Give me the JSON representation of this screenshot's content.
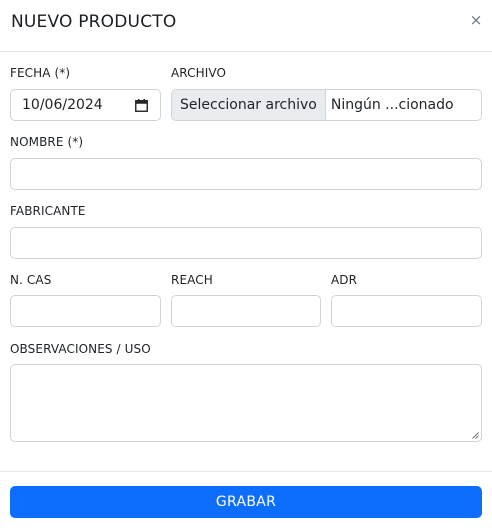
{
  "modal": {
    "title": "NUEVO PRODUCTO",
    "close_symbol": "×"
  },
  "form": {
    "fecha_label": "FECHA (*)",
    "fecha_value": "10/06/2024",
    "archivo_label": "ARCHIVO",
    "archivo_button": "Seleccionar archivo",
    "archivo_status": "Ningún ...cionado",
    "nombre_label": "NOMBRE (*)",
    "nombre_value": "",
    "fabricante_label": "FABRICANTE",
    "fabricante_value": "",
    "ncas_label": "N. CAS",
    "ncas_value": "",
    "reach_label": "REACH",
    "reach_value": "",
    "adr_label": "ADR",
    "adr_value": "",
    "observaciones_label": "OBSERVACIONES / USO",
    "observaciones_value": ""
  },
  "footer": {
    "submit_label": "GRABAR"
  },
  "colors": {
    "primary": "#0d6efd",
    "border": "#ced4da",
    "file_button_bg": "#e9ecef"
  },
  "icons": {
    "calendar": "calendar-icon",
    "close": "close-icon",
    "resize": "resize-handle-icon"
  }
}
